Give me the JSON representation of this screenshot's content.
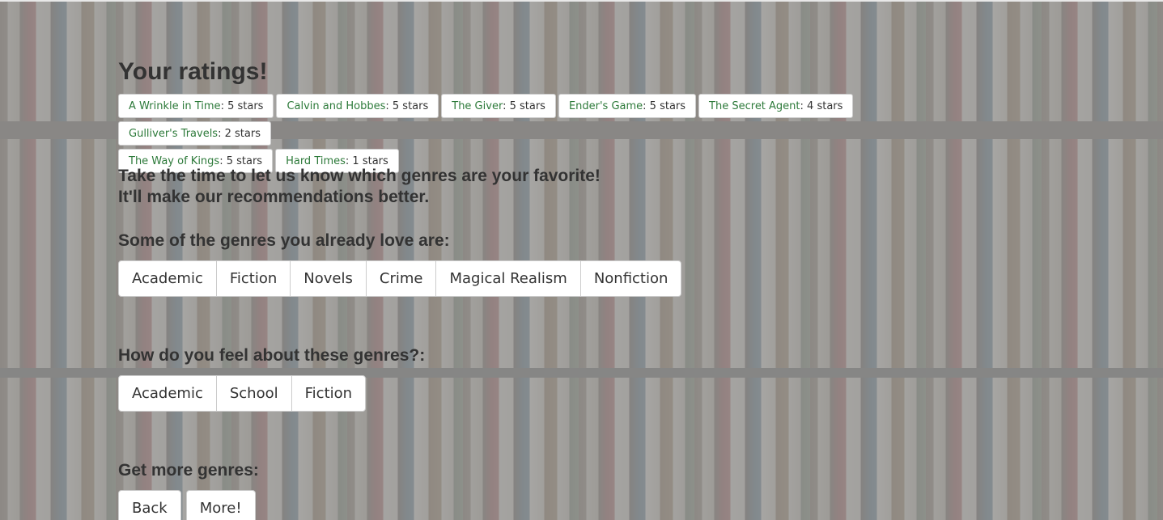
{
  "heading": "Your ratings!",
  "ratings": [
    {
      "title": "A Wrinkle in Time",
      "stars": ": 5 stars"
    },
    {
      "title": "Calvin and Hobbes",
      "stars": ": 5 stars"
    },
    {
      "title": "The Giver",
      "stars": ": 5 stars"
    },
    {
      "title": "Ender's Game",
      "stars": ": 5 stars"
    },
    {
      "title": "The Secret Agent",
      "stars": ": 4 stars"
    },
    {
      "title": "Gulliver's Travels",
      "stars": ": 2 stars"
    },
    {
      "title": "The Way of Kings",
      "stars": ": 5 stars"
    },
    {
      "title": "Hard Times",
      "stars": ": 1 stars"
    }
  ],
  "prompt": {
    "line1": "Take the time to let us know which genres are your favorite!",
    "line2": "It'll make our recommendations better."
  },
  "loved": {
    "heading": "Some of the genres you already love are:",
    "genres": [
      "Academic",
      "Fiction",
      "Novels",
      "Crime",
      "Magical Realism",
      "Nonfiction"
    ]
  },
  "feel": {
    "heading": "How do you feel about these genres?:",
    "genres": [
      "Academic",
      "School",
      "Fiction"
    ]
  },
  "more": {
    "heading": "Get more genres:",
    "back_label": "Back",
    "more_label": "More!"
  },
  "colors": {
    "title_link": "#2d7a3a",
    "text": "#333333",
    "overlay": "#969696"
  }
}
